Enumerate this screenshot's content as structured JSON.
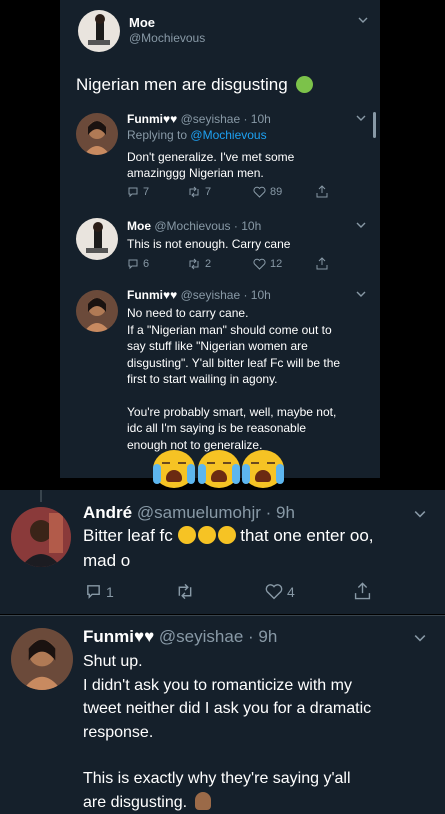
{
  "tweet_main": {
    "name": "Moe",
    "handle": "@Mochievous",
    "text": "Nigerian men are disgusting"
  },
  "reply1": {
    "name": "Funmi♥♥",
    "meta": "@seyishae · 10h",
    "replying_prefix": "Replying to",
    "replying_to": "@Mochievous",
    "lines": [
      "Don't generalize. I've met some",
      "amazinggg Nigerian men."
    ],
    "comments": "7",
    "retweets": "7",
    "likes": "89"
  },
  "reply2": {
    "name": "Moe",
    "meta": "@Mochievous · 10h",
    "lines": [
      "This is not enough. Carry cane"
    ],
    "comments": "6",
    "retweets": "2",
    "likes": "12"
  },
  "reply3": {
    "name": "Funmi♥♥",
    "meta": "@seyishae · 10h",
    "lines": [
      "No need to carry cane.",
      "If a \"Nigerian man\" should come out to",
      "say stuff like \"Nigerian women are",
      "disgusting\".  Y'all bitter leaf Fc will be the",
      "first to start wailing in agony.",
      "",
      "You're probably smart, well, maybe not,",
      "idc all I'm saying is be reasonable",
      "enough not to generalize."
    ]
  },
  "andre": {
    "name": "André",
    "meta": "@samuelumohjr · 9h",
    "line1_pre": "Bitter leaf fc",
    "line1_post": "that one enter oo,",
    "line2": "mad o",
    "comments": "1",
    "likes": "4"
  },
  "funmi_last": {
    "name": "Funmi♥♥",
    "meta": "@seyishae · 9h",
    "lines": [
      "Shut up.",
      "I didn't ask you to romanticize with my",
      "tweet neither did I ask you for a dramatic",
      "response.",
      "",
      "This is exactly why they're saying y'all",
      "are disgusting."
    ]
  },
  "colors": {
    "background": "#15202b",
    "accent": "#1da1f2",
    "secondary_text": "#8899a6",
    "emoji": "#f6c324"
  },
  "icons": [
    "comment-icon",
    "retweet-icon",
    "like-icon",
    "share-icon",
    "chevron-down-icon",
    "nauseated-face-emoji",
    "crying-face-emoji",
    "laughing-face-emoji",
    "facepalm-emoji"
  ]
}
